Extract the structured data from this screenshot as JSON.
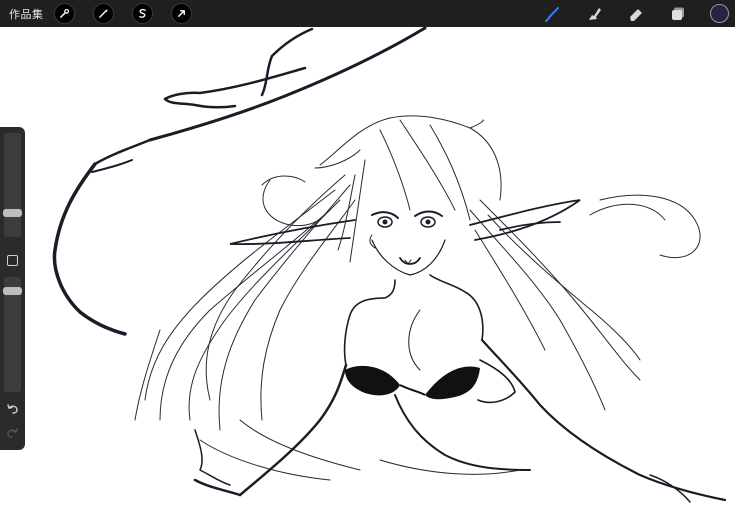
{
  "toolbar": {
    "gallery_label": "作品集",
    "left_tools": [
      {
        "name": "actions",
        "icon": "wrench-icon"
      },
      {
        "name": "adjustments",
        "icon": "magic-wand-icon"
      },
      {
        "name": "selection",
        "icon": "selection-s-icon"
      },
      {
        "name": "transform",
        "icon": "arrow-cursor-icon"
      }
    ],
    "right_tools": [
      {
        "name": "brush",
        "icon": "brush-icon",
        "active": true
      },
      {
        "name": "smudge",
        "icon": "smudge-icon"
      },
      {
        "name": "eraser",
        "icon": "eraser-icon"
      },
      {
        "name": "layers",
        "icon": "layers-icon"
      }
    ],
    "current_color": "#232545",
    "active_color": "#2f7bff"
  },
  "sidebar": {
    "brush_size_level": 0.77,
    "opacity_level": 0.04,
    "undo_icon": "undo-icon",
    "redo_icon": "redo-icon",
    "modify_icon": "square-modify-icon"
  },
  "canvas": {
    "background": "#ffffff",
    "ink_color": "#1c1c28"
  }
}
